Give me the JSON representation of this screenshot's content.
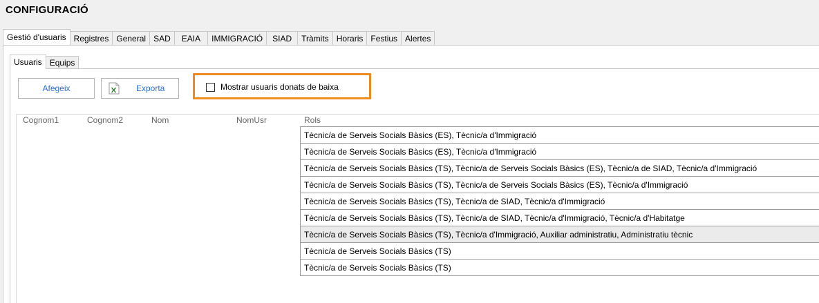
{
  "page_title": "CONFIGURACIÓ",
  "main_tabs": [
    "Gestió d'usuaris",
    "Registres",
    "General",
    "SAD",
    "EAIA",
    "IMMIGRACIÓ",
    "SIAD",
    "Tràmits",
    "Horaris",
    "Festius",
    "Alertes"
  ],
  "sub_tabs": [
    "Usuaris",
    "Equips"
  ],
  "toolbar": {
    "add_label": "Afegeix",
    "export_label": "Exporta",
    "show_inactive_label": "Mostrar usuaris donats de baixa",
    "show_inactive_checked": false
  },
  "grid": {
    "columns": [
      "Cognom1",
      "Cognom2",
      "Nom",
      "NomUsr",
      "Rols"
    ],
    "rows": [
      "Tècnic/a de Serveis Socials Bàsics (ES), Tècnic/a d'Immigració",
      "Tècnic/a de Serveis Socials Bàsics (ES), Tècnic/a d'Immigració",
      "Tècnic/a de Serveis Socials Bàsics (TS), Tècnic/a de Serveis Socials Bàsics (ES), Tècnic/a de SIAD, Tècnic/a d'Immigració",
      "Tècnic/a de Serveis Socials Bàsics (TS), Tècnic/a de Serveis Socials Bàsics (ES), Tècnic/a d'Immigració",
      "Tècnic/a de Serveis Socials Bàsics (TS), Tècnic/a de SIAD, Tècnic/a d'Immigració",
      "Tècnic/a de Serveis Socials Bàsics (TS), Tècnic/a de SIAD, Tècnic/a d'Immigració, Tècnic/a d'Habitatge",
      "Tècnic/a de Serveis Socials Bàsics (TS), Tècnic/a d'Immigració, Auxiliar administratiu, Administratiu tècnic",
      "Tècnic/a de Serveis Socials Bàsics (TS)",
      "Tècnic/a de Serveis Socials Bàsics (TS)"
    ],
    "selected_row": 7
  },
  "colors": {
    "accent": "#2f6fd0",
    "highlight": "#f08a1e",
    "excel_green": "#3c8a3c"
  },
  "icons": {
    "export": "excel-file-icon"
  }
}
